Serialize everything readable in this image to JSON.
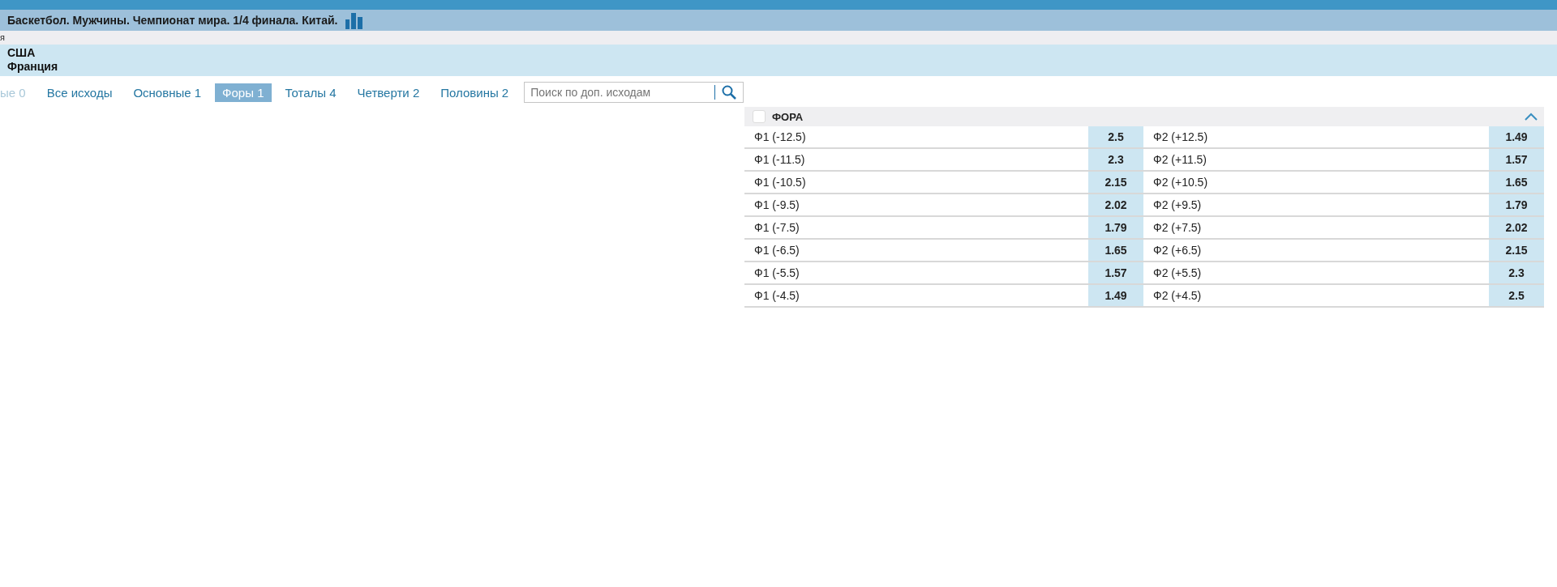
{
  "event_title": "Баскетбол. Мужчины. Чемпионат мира. 1/4 финала. Китай.",
  "breadcrumb_fragment": "я",
  "teams": [
    "США",
    "Франция"
  ],
  "tabs": [
    {
      "label": "ые 0",
      "selected": false,
      "disabled": true
    },
    {
      "label": "Все исходы",
      "selected": false,
      "disabled": false
    },
    {
      "label": "Основные 1",
      "selected": false,
      "disabled": false
    },
    {
      "label": "Форы 1",
      "selected": true,
      "disabled": false
    },
    {
      "label": "Тоталы 4",
      "selected": false,
      "disabled": false
    },
    {
      "label": "Четверти 2",
      "selected": false,
      "disabled": false
    },
    {
      "label": "Половины 2",
      "selected": false,
      "disabled": false
    }
  ],
  "search": {
    "placeholder": "Поиск по доп. исходам"
  },
  "market": {
    "title": "ФОРА",
    "checked": false,
    "expanded": true,
    "rows": [
      {
        "outcome_1": "Ф1 (-12.5)",
        "odds_1": "2.5",
        "outcome_2": "Ф2 (+12.5)",
        "odds_2": "1.49"
      },
      {
        "outcome_1": "Ф1 (-11.5)",
        "odds_1": "2.3",
        "outcome_2": "Ф2 (+11.5)",
        "odds_2": "1.57"
      },
      {
        "outcome_1": "Ф1 (-10.5)",
        "odds_1": "2.15",
        "outcome_2": "Ф2 (+10.5)",
        "odds_2": "1.65"
      },
      {
        "outcome_1": "Ф1 (-9.5)",
        "odds_1": "2.02",
        "outcome_2": "Ф2 (+9.5)",
        "odds_2": "1.79"
      },
      {
        "outcome_1": "Ф1 (-7.5)",
        "odds_1": "1.79",
        "outcome_2": "Ф2 (+7.5)",
        "odds_2": "2.02"
      },
      {
        "outcome_1": "Ф1 (-6.5)",
        "odds_1": "1.65",
        "outcome_2": "Ф2 (+6.5)",
        "odds_2": "2.15"
      },
      {
        "outcome_1": "Ф1 (-5.5)",
        "odds_1": "1.57",
        "outcome_2": "Ф2 (+5.5)",
        "odds_2": "2.3"
      },
      {
        "outcome_1": "Ф1 (-4.5)",
        "odds_1": "1.49",
        "outcome_2": "Ф2 (+4.5)",
        "odds_2": "2.5"
      }
    ]
  }
}
